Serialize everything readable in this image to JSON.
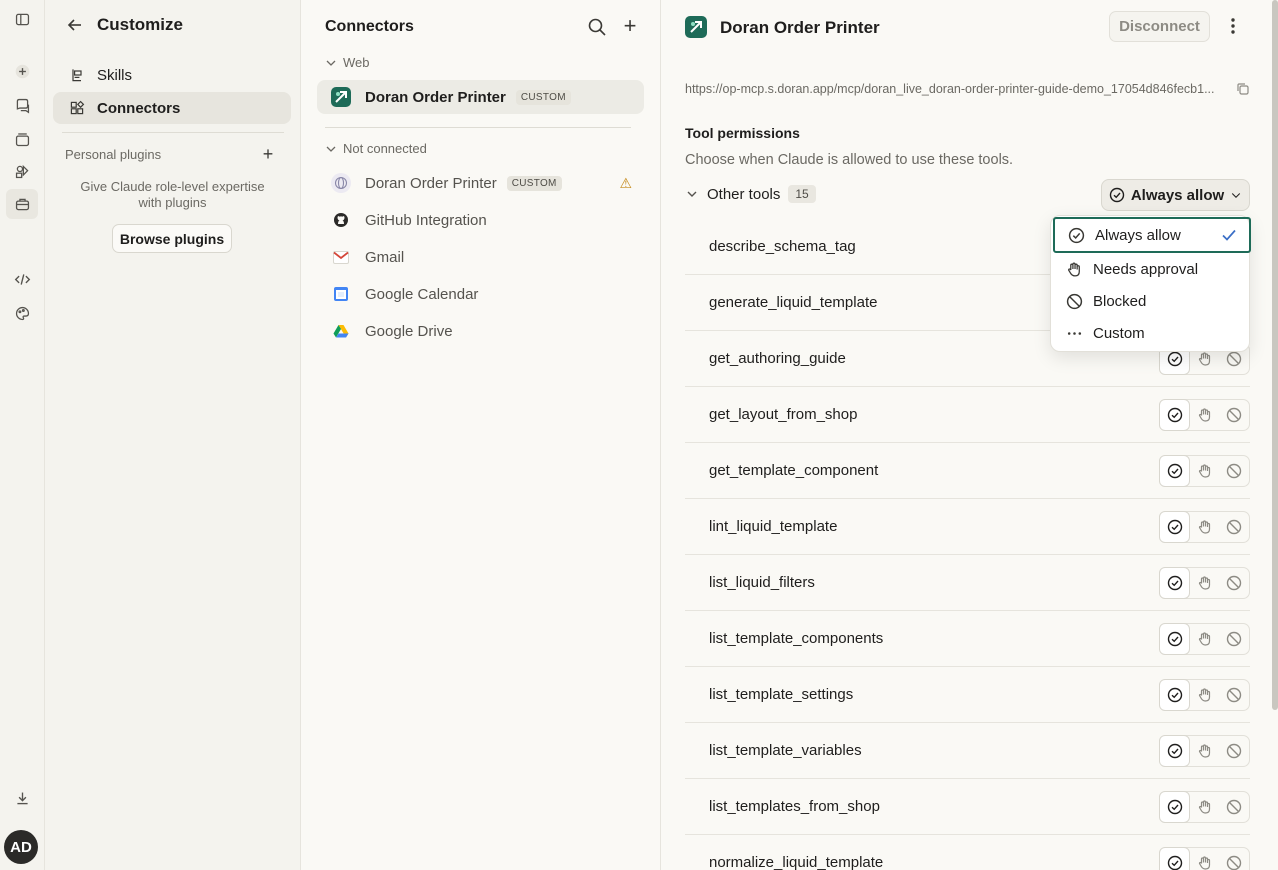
{
  "user": {
    "initials": "AD"
  },
  "customize": {
    "title": "Customize",
    "nav": [
      {
        "label": "Skills"
      },
      {
        "label": "Connectors"
      }
    ],
    "personal_plugins_label": "Personal plugins",
    "plugins_desc": "Give Claude role-level expertise with plugins",
    "browse_label": "Browse plugins"
  },
  "connectors": {
    "title": "Connectors",
    "web_section": "Web",
    "web_items": [
      {
        "name": "Doran Order Printer",
        "badge": "CUSTOM"
      }
    ],
    "not_connected_section": "Not connected",
    "not_connected_items": [
      {
        "name": "Doran Order Printer",
        "badge": "CUSTOM",
        "warning": true
      },
      {
        "name": "GitHub Integration"
      },
      {
        "name": "Gmail"
      },
      {
        "name": "Google Calendar"
      },
      {
        "name": "Google Drive"
      }
    ]
  },
  "detail": {
    "title": "Doran Order Printer",
    "disconnect_label": "Disconnect",
    "url": "https://op-mcp.s.doran.app/mcp/doran_live_doran-order-printer-guide-demo_17054d846fecb1...",
    "permissions_title": "Tool permissions",
    "permissions_desc": "Choose when Claude is allowed to use these tools.",
    "group_label": "Other tools",
    "group_count": "15",
    "group_setting": "Always allow",
    "tools": [
      "describe_schema_tag",
      "generate_liquid_template",
      "get_authoring_guide",
      "get_layout_from_shop",
      "get_template_component",
      "lint_liquid_template",
      "list_liquid_filters",
      "list_template_components",
      "list_template_settings",
      "list_template_variables",
      "list_templates_from_shop",
      "normalize_liquid_template"
    ]
  },
  "dropdown": {
    "options": [
      {
        "label": "Always allow",
        "selected": true
      },
      {
        "label": "Needs approval"
      },
      {
        "label": "Blocked"
      },
      {
        "label": "Custom"
      }
    ]
  },
  "colors": {
    "accent": "#1e6b58",
    "check": "#3a6ec6",
    "warning": "#c58a1a"
  }
}
